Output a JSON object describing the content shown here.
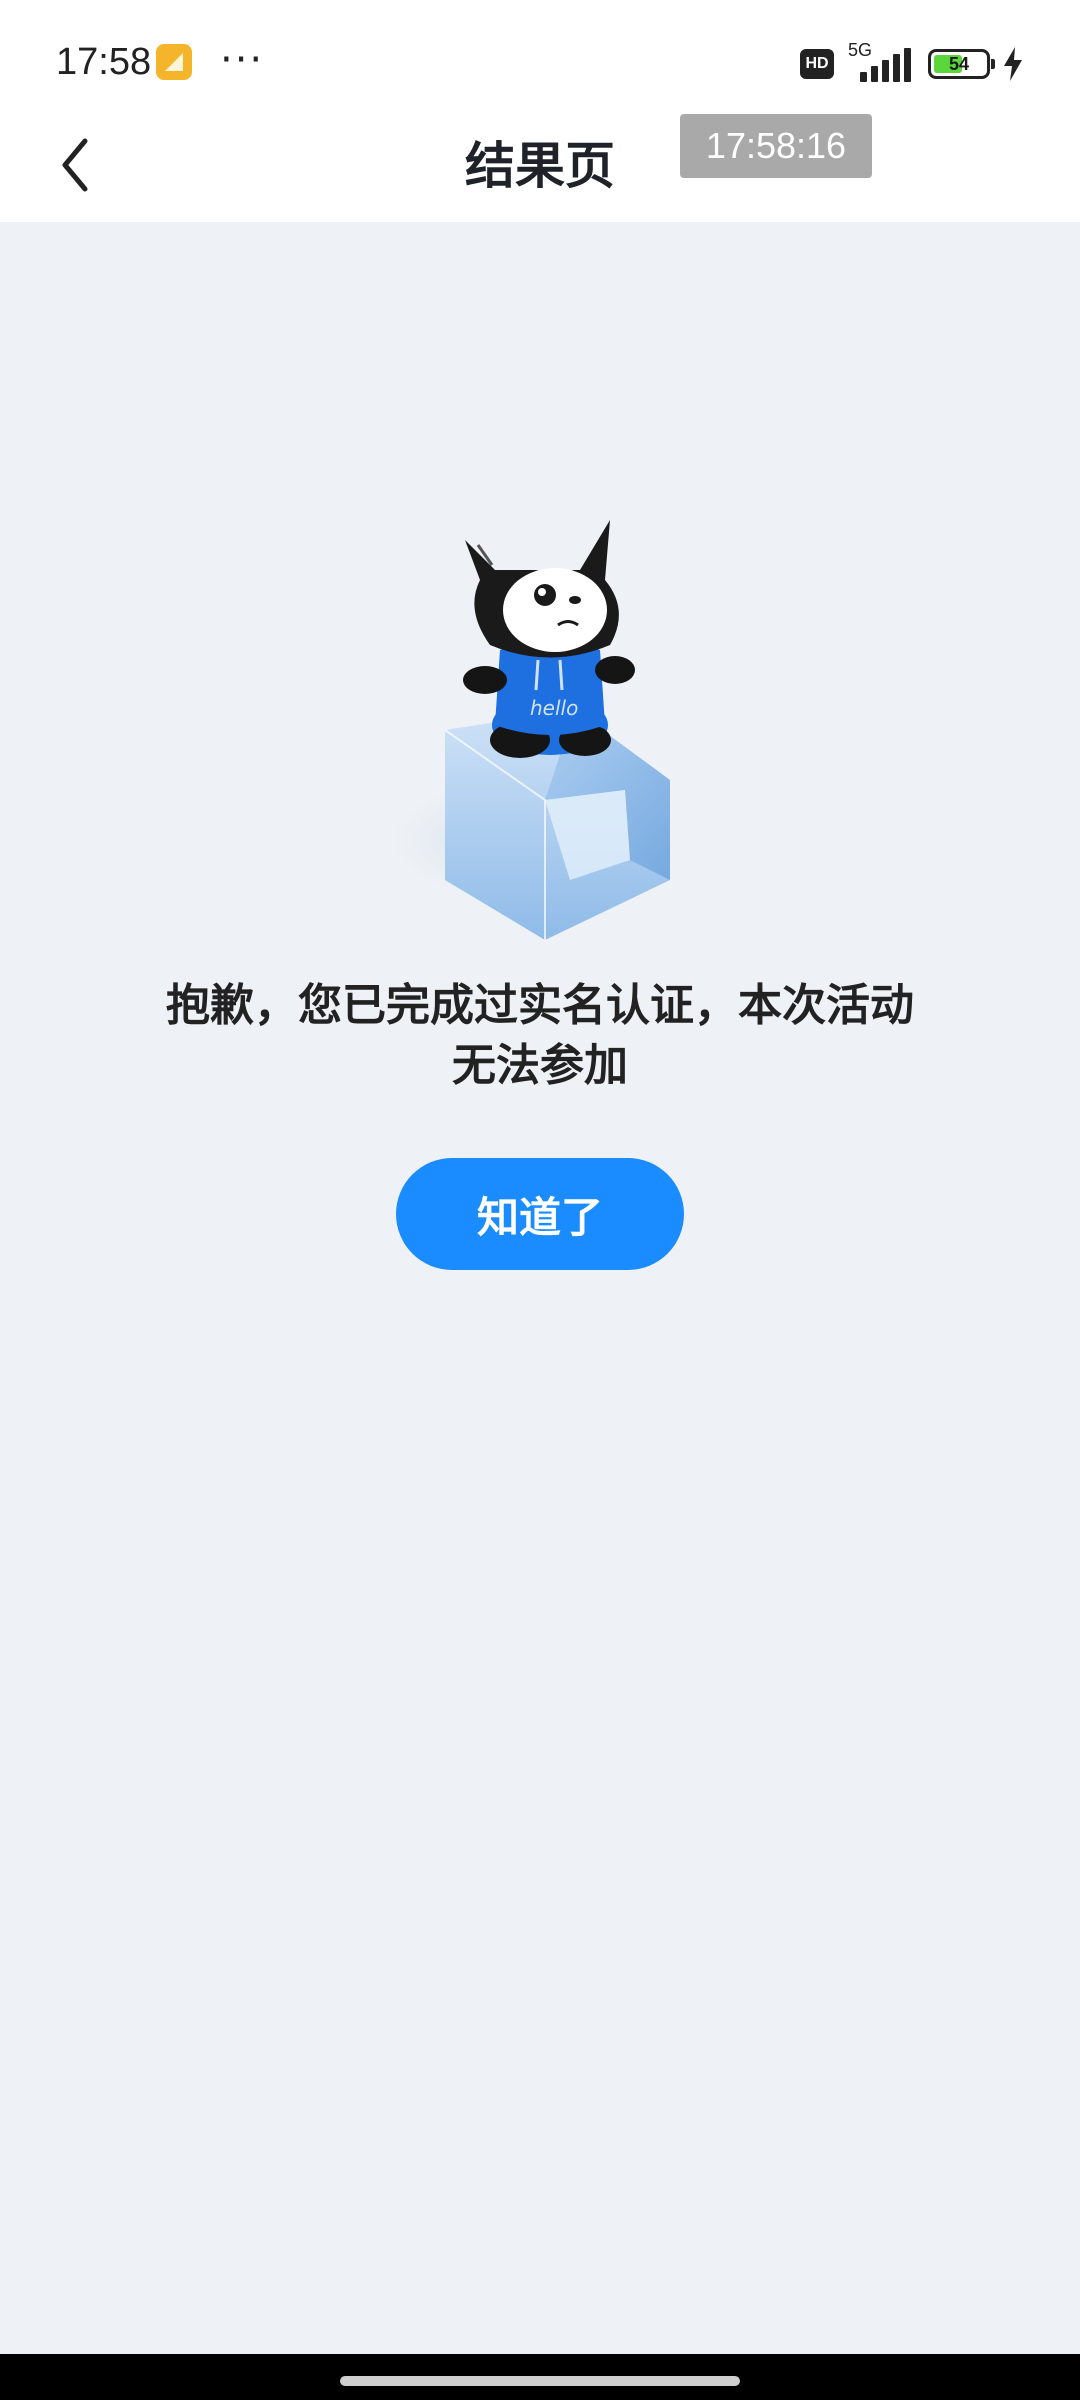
{
  "status_bar": {
    "time": "17:58",
    "more": "···",
    "network_badge": "HD",
    "network_type": "5G",
    "battery_level": "54",
    "icons": [
      "notes-app-icon",
      "hd-icon",
      "signal-icon",
      "battery-icon",
      "charging-bolt-icon"
    ]
  },
  "header": {
    "title": "结果页",
    "time_overlay": "17:58:16",
    "back_icon": "chevron-left-icon"
  },
  "main": {
    "illustration": "mascot-illustration",
    "message": "抱歉，您已完成过实名认证，本次活动无法参加",
    "ok_button_label": "知道了",
    "accent_color": "#1a8cff",
    "background_color": "#eef1f5"
  }
}
